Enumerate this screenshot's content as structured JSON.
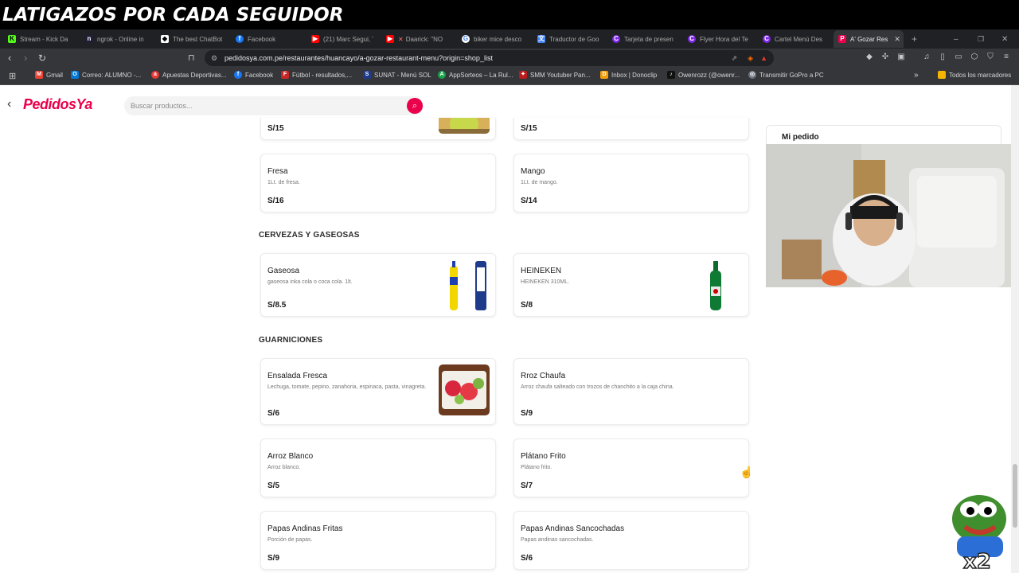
{
  "banner": {
    "text": "LATIGAZOS POR CADA SEGUIDOR"
  },
  "tabs": [
    {
      "label": "Stream - Kick Da",
      "icon": "kick-icon",
      "color": "#53fc18"
    },
    {
      "label": "ngrok - Online in",
      "icon": "ngrok-icon",
      "color": "#1f1e37"
    },
    {
      "label": "The best ChatBot",
      "icon": "chatbot-icon",
      "color": "#ffffff"
    },
    {
      "label": "Facebook",
      "icon": "facebook-icon",
      "color": "#1877f2"
    },
    {
      "label": "(21) Marc Segui, T",
      "icon": "youtube-icon",
      "color": "#ff0000"
    },
    {
      "label": "Daarick: \"NO",
      "icon": "youtube-icon",
      "color": "#ff0000"
    },
    {
      "label": "biker mice desco",
      "icon": "google-icon",
      "color": "#ffffff"
    },
    {
      "label": "Traductor de Goo",
      "icon": "translate-icon",
      "color": "#4285f4"
    },
    {
      "label": "Tarjeta de presen",
      "icon": "canva-icon",
      "color": "#7d2ae8"
    },
    {
      "label": "Flyer Hora del Te",
      "icon": "canva-icon",
      "color": "#7d2ae8"
    },
    {
      "label": "Cartel Menú Des",
      "icon": "canva-icon",
      "color": "#7d2ae8"
    },
    {
      "label": "A' Gozar Res",
      "icon": "pedidosya-icon",
      "color": "#ea004b"
    }
  ],
  "address": {
    "url": "pedidosya.com.pe/restaurantes/huancayo/a-gozar-restaurant-menu?origin=shop_list"
  },
  "bookmarks": [
    {
      "label": "Gmail",
      "icon": "gmail-icon",
      "color": "#ea4335"
    },
    {
      "label": "Correo: ALUMNO -...",
      "icon": "outlook-icon",
      "color": "#0078d4"
    },
    {
      "label": "Apuestas Deportivas...",
      "icon": "bet-icon",
      "color": "#e53935"
    },
    {
      "label": "Facebook",
      "icon": "facebook-icon",
      "color": "#1877f2"
    },
    {
      "label": "Fútbol - resultados,...",
      "icon": "football-icon",
      "color": "#c62828"
    },
    {
      "label": "SUNAT - Menú SOL",
      "icon": "sunat-icon",
      "color": "#1e3a8a"
    },
    {
      "label": "AppSorteos – La Rul...",
      "icon": "appsorteos-icon",
      "color": "#16a34a"
    },
    {
      "label": "SMM Youtuber Pan...",
      "icon": "smm-icon",
      "color": "#b91c1c"
    },
    {
      "label": "Inbox | Donoclip",
      "icon": "donoclip-icon",
      "color": "#f59e0b"
    },
    {
      "label": "Owenrozz (@owenr...",
      "icon": "tiktok-icon",
      "color": "#111111"
    },
    {
      "label": "Transmitir GoPro a PC",
      "icon": "gopro-icon",
      "color": "#6b7280"
    },
    {
      "label": "Todos los marcadores",
      "icon": "folder-icon",
      "color": "#f4b400"
    }
  ],
  "site": {
    "logo": "PedidosYa",
    "search_placeholder": "Buscar productos...",
    "order_title": "Mi pedido"
  },
  "menu": {
    "top_row": [
      {
        "price": "S/15"
      },
      {
        "price": "S/15"
      }
    ],
    "juices": [
      {
        "name": "Fresa",
        "desc": "1Lt. de fresa.",
        "price": "S/16"
      },
      {
        "name": "Mango",
        "desc": "1Lt. de mango.",
        "price": "S/14"
      }
    ],
    "section_drinks": "CERVEZAS Y GASEOSAS",
    "drinks": [
      {
        "name": "Gaseosa",
        "desc": "gaseosa inka cola o coca cola. 1lt.",
        "price": "S/8.5"
      },
      {
        "name": "HEINEKEN",
        "desc": "HEINEKEN 310ML.",
        "price": "S/8"
      }
    ],
    "section_sides": "GUARNICIONES",
    "sides": [
      {
        "name": "Ensalada Fresca",
        "desc": "Lechuga, tomate, pepino, zanahoria, espinaca, pasta, vinagreta.",
        "price": "S/6"
      },
      {
        "name": "Rroz Chaufa",
        "desc": "Arroz chaufa salteado con trozos de chanchito a la caja china.",
        "price": "S/9"
      },
      {
        "name": "Arroz Blanco",
        "desc": "Arroz blanco.",
        "price": "S/5"
      },
      {
        "name": "Plátano Frito",
        "desc": "Plátano frito.",
        "price": "S/7"
      },
      {
        "name": "Papas Andinas Fritas",
        "desc": "Porción de papas.",
        "price": "S/9"
      },
      {
        "name": "Papas Andinas Sancochadas",
        "desc": "Papas andinas sancochadas.",
        "price": "S/6"
      }
    ]
  },
  "colors": {
    "brand": "#ea004b",
    "chrome_dark": "#202124",
    "chrome": "#35363a"
  }
}
